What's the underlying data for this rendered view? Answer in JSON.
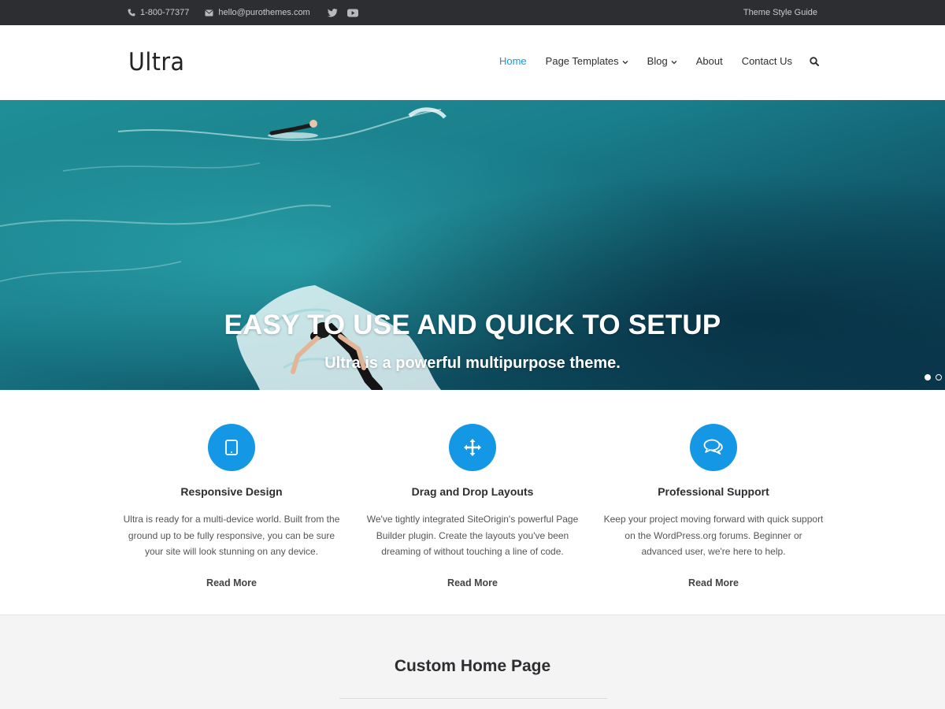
{
  "topbar": {
    "phone": "1-800-77377",
    "email": "hello@purothemes.com",
    "social": [
      "twitter-icon",
      "youtube-icon"
    ],
    "style_guide": "Theme Style Guide"
  },
  "header": {
    "logo": "Ultra",
    "nav": [
      {
        "label": "Home",
        "active": true,
        "dropdown": false
      },
      {
        "label": "Page Templates",
        "active": false,
        "dropdown": true
      },
      {
        "label": "Blog",
        "active": false,
        "dropdown": true
      },
      {
        "label": "About",
        "active": false,
        "dropdown": false
      },
      {
        "label": "Contact Us",
        "active": false,
        "dropdown": false
      }
    ],
    "search_icon": "search-icon"
  },
  "hero": {
    "title": "EASY TO USE AND QUICK TO SETUP",
    "subtitle": "Ultra is a powerful multipurpose theme.",
    "slides": 2,
    "active_slide": 1
  },
  "features": [
    {
      "icon": "tablet-icon",
      "title": "Responsive Design",
      "text": "Ultra is ready for a multi-device world. Built from the ground up to be fully responsive, you can be sure your site will look stunning on any device.",
      "link": "Read More"
    },
    {
      "icon": "move-arrows-icon",
      "title": "Drag and Drop Layouts",
      "text": "We've tightly integrated SiteOrigin's powerful Page Builder plugin. Create the layouts you've been dreaming of without touching a line of code.",
      "link": "Read More"
    },
    {
      "icon": "chat-bubbles-icon",
      "title": "Professional Support",
      "text": "Keep your project moving forward with quick support on the WordPress.org forums. Beginner or advanced user, we're here to help.",
      "link": "Read More"
    }
  ],
  "custom_section": {
    "title": "Custom Home Page"
  },
  "colors": {
    "accent": "#1497e4",
    "topbar_bg": "#2d2e32",
    "section_bg": "#f4f4f4"
  }
}
